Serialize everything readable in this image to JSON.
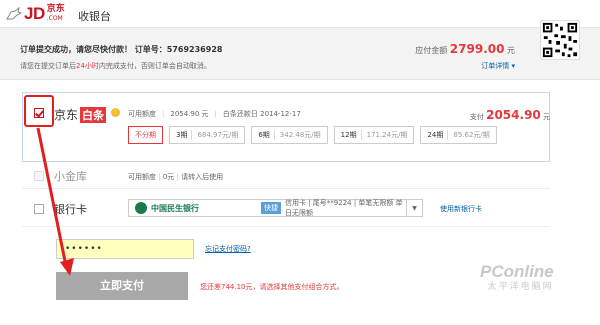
{
  "header": {
    "logo_text": "JD",
    "logo_cn": "京东",
    "logo_com": ".COM",
    "title": "收银台"
  },
  "order": {
    "message": "订单提交成功，请您尽快付款！ 订单号：5769236928",
    "note_prefix": "请您在提交订单后",
    "note_highlight": "24小时",
    "note_suffix": "内完成支付，否则订单会自动取消。",
    "due_label": "应付金额",
    "due_amount": "2799.00",
    "due_unit": "元",
    "detail_link": "订单详情 ▾"
  },
  "baitiao": {
    "label": "京东",
    "tag": "白条",
    "info_icon": "!",
    "available_label": "可用额度",
    "available_value": "2054.90 元",
    "due_date": "白条还款日 2014-12-17",
    "pay_label": "支付",
    "pay_amount": "2054.90",
    "pay_unit": "元",
    "terms": [
      {
        "label": "不分期",
        "rate": "",
        "selected": true
      },
      {
        "label": "3期",
        "rate": "684.97元/期",
        "selected": false
      },
      {
        "label": "6期",
        "rate": "342.48元/期",
        "selected": false
      },
      {
        "label": "12期",
        "rate": "171.24元/期",
        "selected": false
      },
      {
        "label": "24期",
        "rate": "85.62元/期",
        "selected": false
      }
    ]
  },
  "xiaojinku": {
    "label": "小金库",
    "available_label": "可用额度",
    "available_value": "0元",
    "note": "请转入后使用"
  },
  "bankcard": {
    "label": "银行卡",
    "bank_name": "中国民生银行",
    "quick": "快捷",
    "desc": "信用卡 | 尾号**9224 | 单笔无限额 单日无限额",
    "caret": "▼",
    "other_link": "使用新银行卡"
  },
  "password": {
    "mask": "••••••",
    "forgot_link": "忘记支付密码?"
  },
  "pay_button": "立即支付",
  "shortage": "您还差744.10元，请选择其他支付组合方式。",
  "watermark": {
    "brand": "PConline",
    "cn": "太平洋电脑网"
  },
  "colors": {
    "jd_red": "#c81623",
    "price_red": "#e4393c",
    "link_blue": "#005ea7",
    "button_gray": "#a8a8a8",
    "annotation_red": "#e02020"
  }
}
